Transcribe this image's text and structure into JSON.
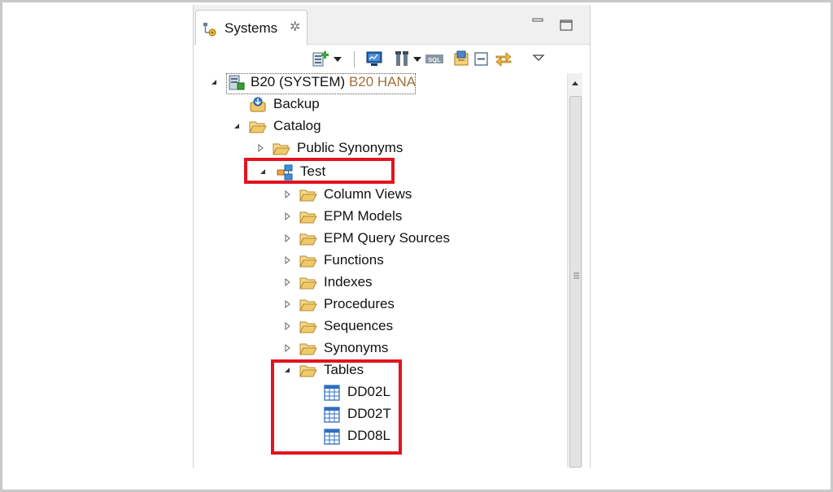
{
  "view": {
    "tab_label": "Systems",
    "tab_close_glyph": "✲",
    "icons": {
      "tab": "systems-view-icon",
      "minimize": "minimize-icon",
      "maximize": "maximize-icon",
      "close": "close-icon"
    }
  },
  "toolbar": {
    "items": [
      "add-system-icon",
      "dropdown-arrow-icon",
      "monitor-icon",
      "tools-icon",
      "dropdown-arrow-icon",
      "sql-console-icon",
      "import-icon",
      "collapse-all-icon",
      "link-with-editor-icon",
      "view-menu-icon"
    ],
    "sql_label": "SQL"
  },
  "tree": {
    "root": {
      "label": "B20 (SYSTEM)",
      "suffix": "B20 HANA",
      "icon": "hana-system-icon",
      "expanded": true
    },
    "backup": {
      "label": "Backup",
      "icon": "backup-icon"
    },
    "catalog": {
      "label": "Catalog",
      "icon": "folder-open-icon",
      "expanded": true
    },
    "public_synonyms": {
      "label": "Public Synonyms",
      "icon": "folder-open-icon",
      "expanded": false
    },
    "test_schema": {
      "label": "Test",
      "icon": "schema-icon",
      "expanded": true
    },
    "test_children": [
      {
        "label": "Column Views",
        "expanded": false
      },
      {
        "label": "EPM Models",
        "expanded": false
      },
      {
        "label": "EPM Query Sources",
        "expanded": false
      },
      {
        "label": "Functions",
        "expanded": false
      },
      {
        "label": "Indexes",
        "expanded": false
      },
      {
        "label": "Procedures",
        "expanded": false
      },
      {
        "label": "Sequences",
        "expanded": false
      },
      {
        "label": "Synonyms",
        "expanded": false
      }
    ],
    "tables": {
      "label": "Tables",
      "icon": "folder-open-icon",
      "expanded": true
    },
    "table_items": [
      {
        "label": "DD02L",
        "icon": "table-icon"
      },
      {
        "label": "DD02T",
        "icon": "table-icon"
      },
      {
        "label": "DD08L",
        "icon": "table-icon"
      }
    ]
  },
  "colors": {
    "highlight_box": "#e3131f",
    "system_suffix": "#a0703b",
    "folder": "#e8b04a"
  }
}
